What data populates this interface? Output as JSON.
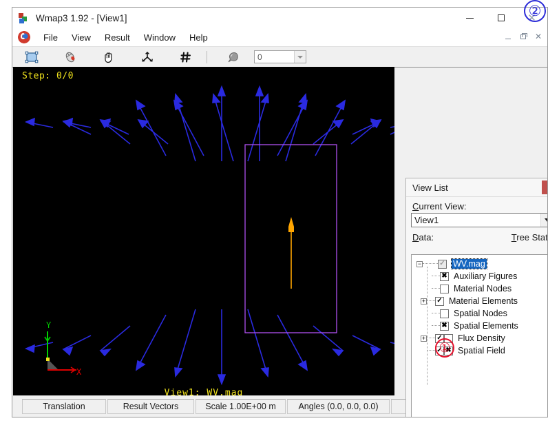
{
  "window": {
    "title": "Wmap3 1.92 - [View1]",
    "app_icon": "app-blocks-icon",
    "controls": {
      "minimize": "—",
      "maximize": "□",
      "close": "✕"
    }
  },
  "menu": {
    "icon": "spiral-logo-icon",
    "items": [
      "File",
      "View",
      "Result",
      "Window",
      "Help"
    ],
    "mdi_controls": {
      "minimize": "–",
      "restore": "❐",
      "close": "✕"
    }
  },
  "toolbar": {
    "buttons": [
      {
        "name": "select-rectangle-icon",
        "title": "Select"
      },
      {
        "name": "mouse-icon",
        "title": "Mouse"
      },
      {
        "name": "hand-pan-icon",
        "title": "Pan"
      },
      {
        "name": "axes-tripod-icon",
        "title": "Rotate"
      },
      {
        "name": "grid-hash-icon",
        "title": "Grid"
      },
      {
        "name": "drop-pin-icon",
        "title": "Probe"
      }
    ],
    "step_combo": {
      "value": "0",
      "arrow": "chevron-down-icon"
    }
  },
  "viewport": {
    "step_label": "Step: 0/0",
    "view_label": "View1: WV.mag",
    "background": "#000000",
    "rect_color": "#b050f0",
    "vector_color": "#2a2ae0",
    "center_vector_color": "#ffa500",
    "axes": {
      "x_label": "X",
      "x_color": "#e00000",
      "y_label": "Y",
      "y_color": "#00d000"
    }
  },
  "status_bar": {
    "cells": [
      "Translation",
      "Result Vectors",
      "Scale 1.00E+00 m",
      "Angles (0.0, 0.0, 0.0)",
      ""
    ]
  },
  "view_list": {
    "title": "View List",
    "close_label": "x",
    "current_view_label": "Current View:",
    "current_view_value": "View1",
    "data_label": "Data:",
    "tree_state_label": "Tree State",
    "tree": [
      {
        "label": "WV.mag",
        "level": 0,
        "expander": "minus",
        "checks": [
          {
            "state": "check",
            "disabled": true
          }
        ],
        "selected": true
      },
      {
        "label": "Auxiliary Figures",
        "level": 1,
        "expander": "none",
        "checks": [
          {
            "state": "cross",
            "disabled": false
          }
        ],
        "selected": false
      },
      {
        "label": "Material Nodes",
        "level": 1,
        "expander": "none",
        "checks": [
          {
            "state": "empty",
            "disabled": false
          }
        ],
        "selected": false
      },
      {
        "label": "Material Elements",
        "level": 1,
        "expander": "plus",
        "checks": [
          {
            "state": "check",
            "disabled": false
          }
        ],
        "selected": false
      },
      {
        "label": "Spatial Nodes",
        "level": 1,
        "expander": "none",
        "checks": [
          {
            "state": "empty",
            "disabled": false
          }
        ],
        "selected": false
      },
      {
        "label": "Spatial Elements",
        "level": 1,
        "expander": "none",
        "checks": [
          {
            "state": "cross",
            "disabled": false
          }
        ],
        "selected": false
      },
      {
        "label": "Flux Density",
        "level": 1,
        "expander": "plus",
        "checks": [
          {
            "state": "check",
            "disabled": false
          },
          {
            "state": "empty",
            "disabled": false
          }
        ],
        "selected": false
      },
      {
        "label": "Spatial Field",
        "level": 1,
        "expander": "none",
        "checks": [
          {
            "state": "check",
            "disabled": false
          },
          {
            "state": "cross",
            "disabled": false
          }
        ],
        "selected": false
      }
    ]
  },
  "annotations": [
    {
      "id": "annotation-1",
      "label": "①",
      "color": "#e8112d"
    },
    {
      "id": "annotation-2",
      "label": "②",
      "color": "#2d2dd8"
    }
  ]
}
